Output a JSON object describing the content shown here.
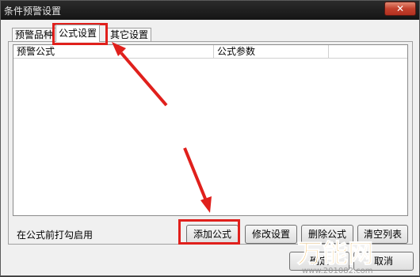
{
  "window": {
    "title": "条件预警设置"
  },
  "tabs": [
    {
      "label": "预警品种"
    },
    {
      "label": "公式设置"
    },
    {
      "label": "其它设置"
    }
  ],
  "list": {
    "columns": [
      "预警公式",
      "公式参数",
      ""
    ]
  },
  "footer": {
    "hint": "在公式前打勾启用"
  },
  "buttons": {
    "add": "添加公式",
    "modify": "修改设置",
    "delete": "删除公式",
    "clear": "清空列表",
    "ok": "确定",
    "cancel": "取消"
  },
  "watermark": {
    "brand": "万能网",
    "url": "www.201082.com"
  },
  "colors": {
    "highlight": "#e0201c",
    "titlebar": "#1e1e1e"
  },
  "icons": {
    "close": "close-icon"
  }
}
